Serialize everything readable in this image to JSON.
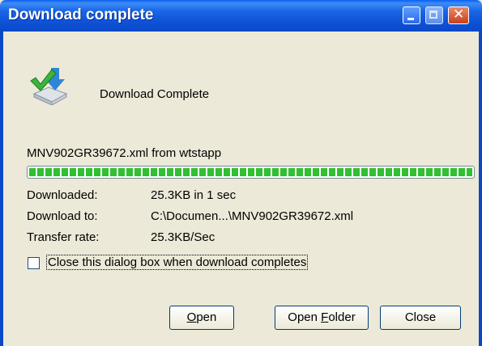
{
  "window": {
    "title": "Download complete",
    "titlebar_color": "#0a48c8"
  },
  "content": {
    "heading": "Download Complete",
    "file_line": "MNV902GR39672.xml from wtstapp",
    "progress_fraction": 1.0,
    "details": [
      {
        "label": "Downloaded:",
        "value": "25.3KB in 1 sec"
      },
      {
        "label": "Download to:",
        "value": "C:\\Documen...\\MNV902GR39672.xml"
      },
      {
        "label": "Transfer rate:",
        "value": "25.3KB/Sec"
      }
    ],
    "close_checkbox_label": "Close this dialog box when download completes",
    "close_checkbox_checked": false
  },
  "buttons": {
    "open": {
      "pre": "",
      "key": "O",
      "post": "pen"
    },
    "open_folder": {
      "pre": "Open ",
      "key": "F",
      "post": "older"
    },
    "close": "Close"
  },
  "icons": {
    "download": "download-complete-icon",
    "minimize": "minimize-icon",
    "maximize": "maximize-icon",
    "close": "close-icon"
  }
}
